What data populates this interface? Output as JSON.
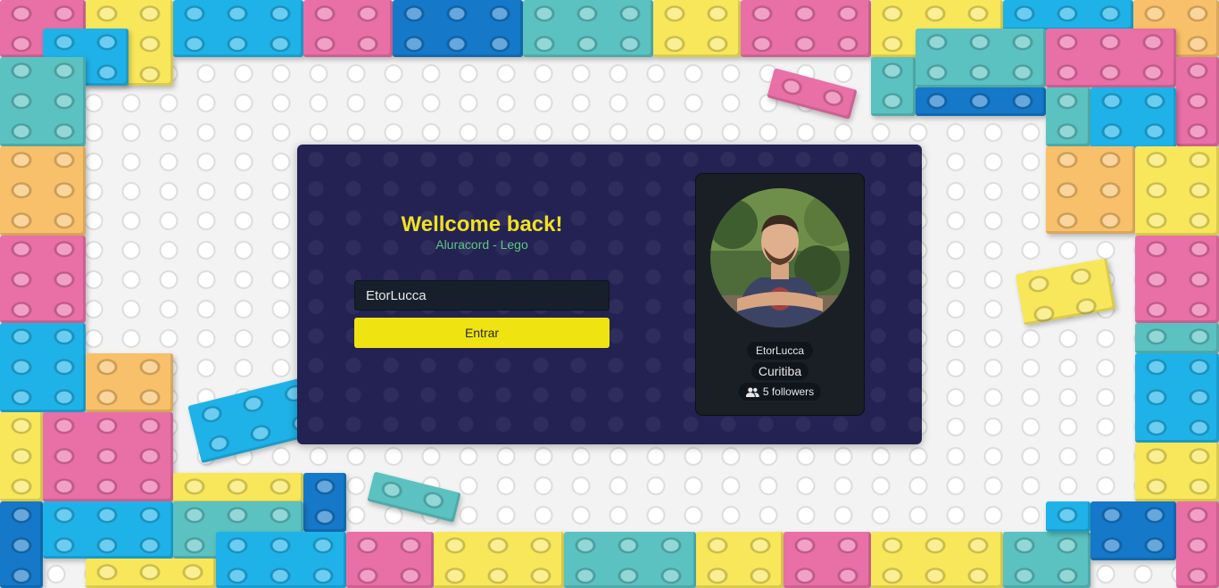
{
  "login": {
    "title": "Wellcome back!",
    "subtitle": "Aluracord - Lego",
    "username_value": "EtorLucca",
    "submit_label": "Entrar"
  },
  "profile": {
    "username": "EtorLucca",
    "location": "Curitiba",
    "followers_text": "5 followers",
    "avatar_icon": "user-photo",
    "followers_icon": "people-icon"
  },
  "colors": {
    "card_background": "#232253",
    "title": "#f0e121",
    "subtitle": "#5ec97f",
    "button": "#f0e312",
    "panel": "#1a1f26"
  }
}
